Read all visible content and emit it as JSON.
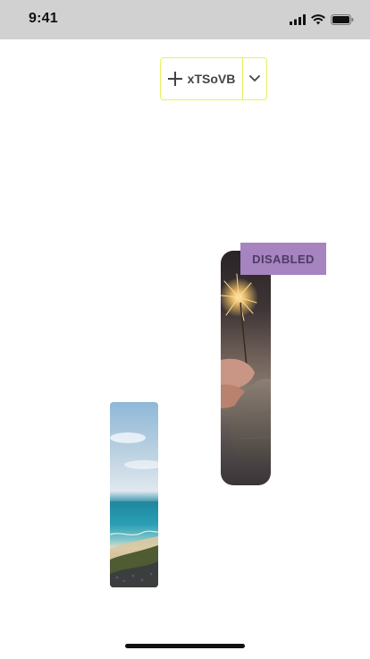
{
  "status_bar": {
    "time": "9:41",
    "icons": [
      "cellular-signal-icon",
      "wifi-icon",
      "battery-icon"
    ]
  },
  "split_button": {
    "label": "xTSoVB",
    "main_icon": "plus-icon",
    "toggle_icon": "chevron-down-icon",
    "border_color": "#e7f05b"
  },
  "disabled_button": {
    "label": "DISABLED",
    "background": "#a584c0"
  },
  "images": [
    {
      "name": "sparkler-image",
      "description_icon": "photo"
    },
    {
      "name": "beach-image",
      "description_icon": "photo"
    }
  ]
}
